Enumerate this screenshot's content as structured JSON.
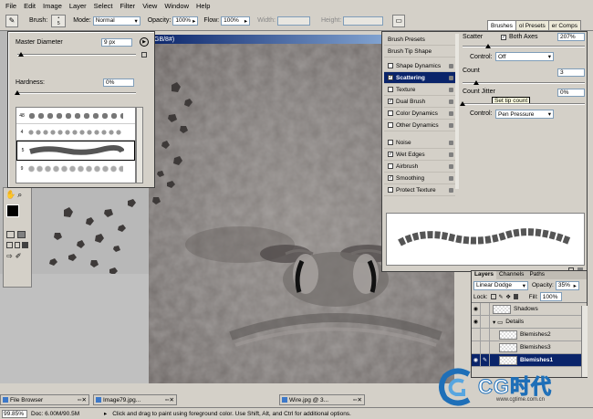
{
  "menu": [
    "File",
    "Edit",
    "Image",
    "Layer",
    "Select",
    "Filter",
    "View",
    "Window",
    "Help"
  ],
  "options_bar": {
    "brush_label": "Brush:",
    "brush_size": "5",
    "mode_label": "Mode:",
    "mode_value": "Normal",
    "opacity_label": "Opacity:",
    "opacity_value": "100%",
    "flow_label": "Flow:",
    "flow_value": "100%",
    "width_label": "Width:",
    "height_label": "Height:"
  },
  "well_tabs": [
    "Brushes",
    "ol Presets",
    "er Comps"
  ],
  "canvas_title": "GB/8#)",
  "brush_popup": {
    "master_label": "Master Diameter",
    "master_value": "9 px",
    "hardness_label": "Hardness:",
    "hardness_value": "0%",
    "presets": [
      {
        "num": "48"
      },
      {
        "num": "4"
      },
      {
        "num": "5"
      },
      {
        "num": "9"
      }
    ]
  },
  "brushes_panel": {
    "items": [
      {
        "label": "Brush Presets",
        "check": false,
        "header": true
      },
      {
        "label": "Brush Tip Shape",
        "check": false,
        "header": true
      },
      {
        "label": "Shape Dynamics",
        "check": false
      },
      {
        "label": "Scattering",
        "check": true,
        "selected": true
      },
      {
        "label": "Texture",
        "check": false
      },
      {
        "label": "Dual Brush",
        "check": true
      },
      {
        "label": "Color Dynamics",
        "check": false
      },
      {
        "label": "Other Dynamics",
        "check": false
      },
      {
        "label": "Noise",
        "check": false
      },
      {
        "label": "Wet Edges",
        "check": true
      },
      {
        "label": "Airbrush",
        "check": false
      },
      {
        "label": "Smoothing",
        "check": true
      },
      {
        "label": "Protect Texture",
        "check": false
      }
    ],
    "scatter_label": "Scatter",
    "both_axes_label": "Both Axes",
    "scatter_value": "207%",
    "control_label": "Control:",
    "control_value": "Off",
    "count_label": "Count",
    "count_value": "3",
    "count_jitter_label": "Count Jitter",
    "count_jitter_value": "0%",
    "tooltip": "Set tip count",
    "control2_label": "Control:",
    "control2_value": "Pen Pressure"
  },
  "layers_panel": {
    "tabs": [
      "Layers",
      "Channels",
      "Paths"
    ],
    "blend_mode": "Linear Dodge",
    "opacity_label": "Opacity:",
    "opacity_value": "35%",
    "lock_label": "Lock:",
    "fill_label": "Fill:",
    "fill_value": "100%",
    "rows": [
      {
        "name": "Shadows",
        "type": "layer"
      },
      {
        "name": "Details",
        "type": "folder"
      },
      {
        "name": "Blemishes2",
        "type": "layer"
      },
      {
        "name": "Blemishes3",
        "type": "layer"
      },
      {
        "name": "Blemishes1",
        "type": "layer",
        "selected": true
      }
    ]
  },
  "taskbar": [
    "File Browser",
    "Image79.jpg...",
    "Wire.jpg @ 3..."
  ],
  "status": {
    "zoom": "99.85%",
    "doc": "Doc: 6.00M/90.5M",
    "hint": "Click and drag to paint using foreground color.  Use Shift, Alt, and Ctrl for additional options."
  },
  "watermark": {
    "brand": "CG时代",
    "url": "www.cgtime.com.cn"
  }
}
